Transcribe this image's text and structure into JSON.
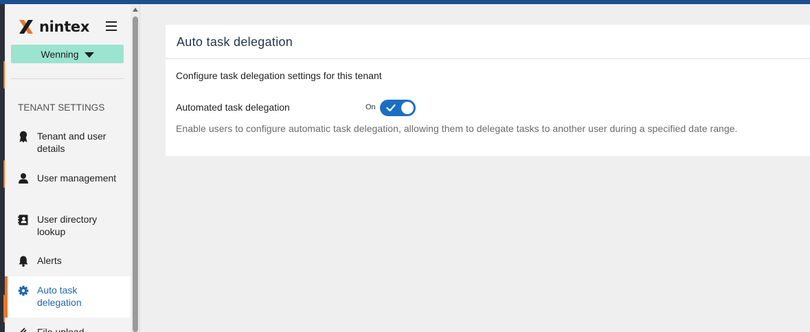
{
  "brand": {
    "name": "nintex",
    "accent": "#e9772c",
    "primary": "#1a6fc2"
  },
  "sidebar": {
    "tenant_selector": "Wenning",
    "section_heading": "TENANT SETTINGS",
    "items": [
      {
        "label": "Tenant and user details",
        "icon": "ribbon-icon",
        "active": false
      },
      {
        "label": "User management",
        "icon": "user-icon",
        "active": false
      },
      {
        "label": "User directory lookup",
        "icon": "contact-book-icon",
        "active": false
      },
      {
        "label": "Alerts",
        "icon": "bell-icon",
        "active": false
      },
      {
        "label": "Auto task delegation",
        "icon": "gear-icon",
        "active": true
      },
      {
        "label": "File upload",
        "icon": "paperclip-icon",
        "active": false
      }
    ]
  },
  "main": {
    "title": "Auto task delegation",
    "description": "Configure task delegation settings for this tenant",
    "setting": {
      "label": "Automated task delegation",
      "state_label": "On",
      "enabled": true,
      "help": "Enable users to configure automatic task delegation, allowing them to delegate tasks to another user during a specified date range."
    }
  }
}
